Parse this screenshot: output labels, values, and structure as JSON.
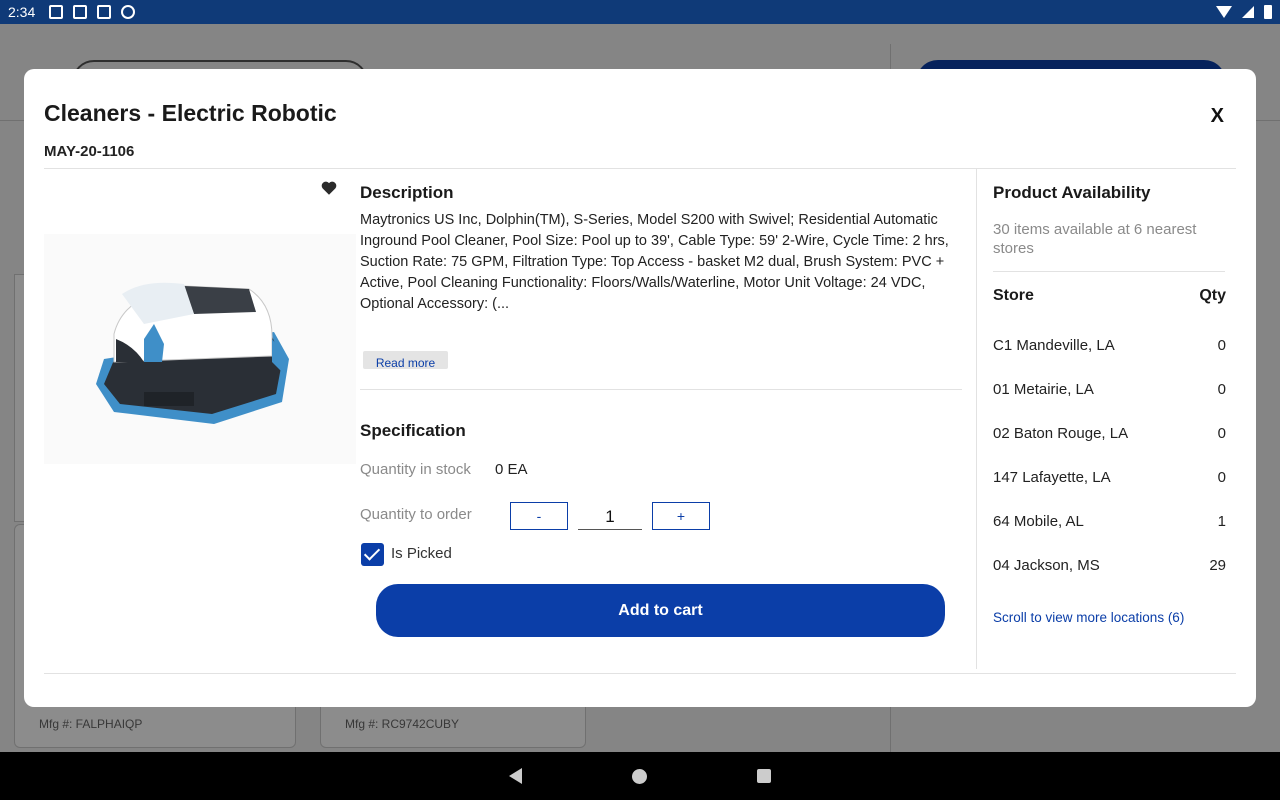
{
  "status_bar": {
    "time": "2:34"
  },
  "background": {
    "cards": [
      {
        "mfg": "Mfg #: FALPHAIQP"
      },
      {
        "mfg": "Mfg #: RC9742CUBY"
      }
    ]
  },
  "modal": {
    "title": "Cleaners - Electric Robotic",
    "sku": "MAY-20-1106",
    "close_label": "X",
    "description": {
      "heading": "Description",
      "text": "Maytronics US Inc, Dolphin(TM), S-Series, Model S200 with Swivel; Residential Automatic Inground Pool Cleaner, Pool Size: Pool up to 39', Cable Type: 59' 2-Wire, Cycle Time: 2 hrs, Suction Rate: 75 GPM, Filtration Type: Top Access - basket M2 dual, Brush System: PVC + Active,  Pool Cleaning Functionality: Floors/Walls/Waterline, Motor Unit Voltage: 24 VDC, Optional Accessory: (...",
      "read_more": "Read more"
    },
    "specification": {
      "heading": "Specification",
      "stock_label": "Quantity in stock",
      "stock_value": "0 EA",
      "order_label": "Quantity to order",
      "minus": "-",
      "plus": "+",
      "quantity": "1",
      "picked_label": "Is Picked",
      "add_to_cart": "Add to cart"
    },
    "availability": {
      "heading": "Product Availability",
      "summary": "30 items available at 6 nearest stores",
      "store_col": "Store",
      "qty_col": "Qty",
      "stores": [
        {
          "name": "C1 Mandeville, LA",
          "qty": "0"
        },
        {
          "name": "01 Metairie, LA",
          "qty": "0"
        },
        {
          "name": "02 Baton Rouge, LA",
          "qty": "0"
        },
        {
          "name": "147 Lafayette, LA",
          "qty": "0"
        },
        {
          "name": "64 Mobile, AL",
          "qty": "1"
        },
        {
          "name": "04 Jackson, MS",
          "qty": "29"
        }
      ],
      "scroll_link": "Scroll to view more locations (6)"
    }
  },
  "colors": {
    "primary": "#0b3ea8",
    "status_bar": "#0f3a78"
  }
}
